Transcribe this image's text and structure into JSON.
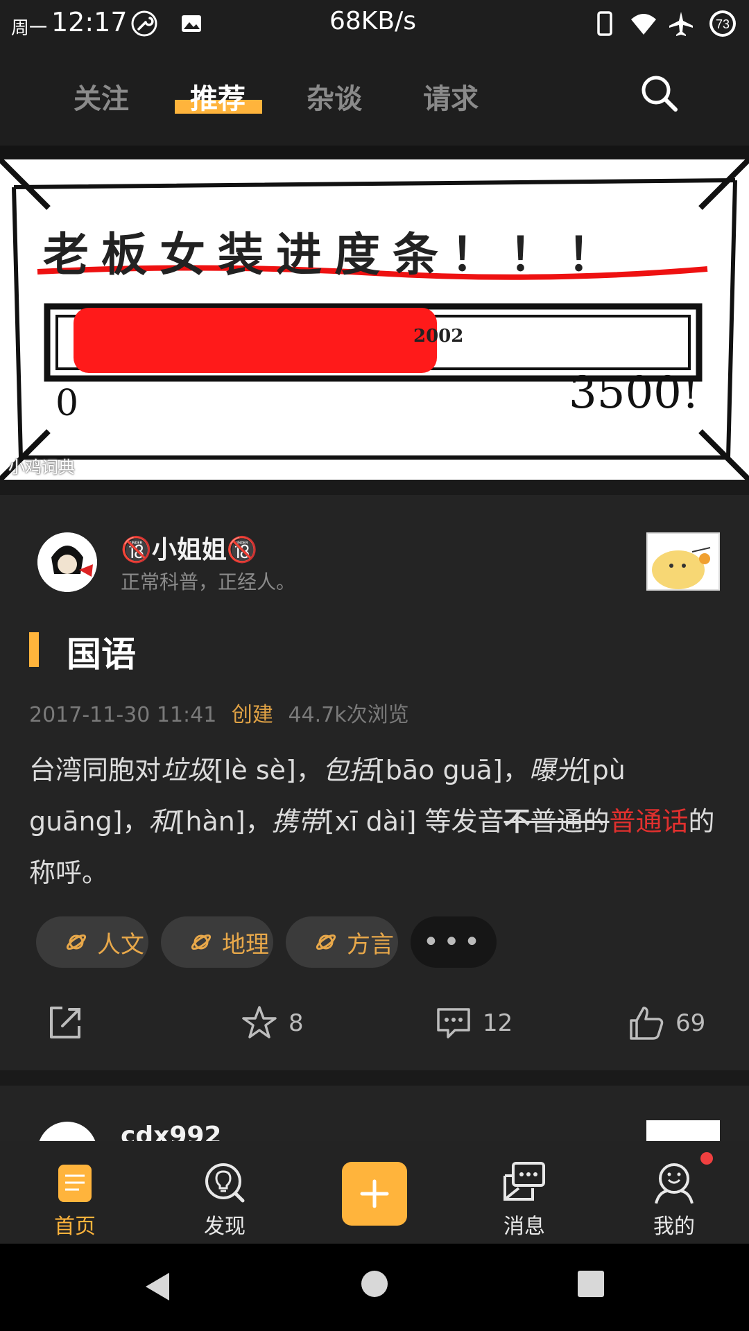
{
  "status_bar": {
    "weekday": "周一",
    "time": "12:17",
    "net_speed": "68KB/s",
    "battery": "73",
    "icons": [
      "wrench-icon",
      "image-icon",
      "phone-icon",
      "wifi-icon",
      "airplane-icon",
      "battery-icon"
    ]
  },
  "top_tabs": {
    "items": [
      "关注",
      "推荐",
      "杂谈",
      "请求"
    ],
    "active": "推荐",
    "accent": "#ffb43c"
  },
  "banner": {
    "title": "老板女装进度条！！！",
    "year_mark": "2002",
    "min": "0",
    "max": "3500!",
    "watermark": "小鸡词典",
    "progress": 0.57
  },
  "post": {
    "username": "🔞小姐姐🔞",
    "bio": "正常科普，正经人。",
    "title": "国语",
    "date": "2017-11-30 11:41",
    "created_label": "创建",
    "views": "44.7k次浏览",
    "body": {
      "p1": "台湾同胞对",
      "w1": "垃圾",
      "r1": "[lè sè]，",
      "w2": "包括",
      "r2": "[bāo guā]，",
      "w3": "曝光",
      "r3": "[pù guāng]，",
      "w4": "和",
      "r4": "[hàn]，",
      "w5": "携带",
      "r5": "[xī dài] 等发音",
      "strike_bold": "不",
      "strike_rest": "普通的",
      "red": "普通话",
      "tail": "的称呼。"
    },
    "tags": [
      "人文",
      "地理",
      "方言"
    ],
    "more_tags": "•••",
    "stats": {
      "favorites": "8",
      "comments": "12",
      "likes": "69"
    }
  },
  "next_post": {
    "username": "cdx992"
  },
  "bottom_nav": {
    "items": [
      {
        "label": "首页",
        "icon": "home-doc-icon",
        "active": true
      },
      {
        "label": "发现",
        "icon": "discover-bulb-icon",
        "active": false
      },
      {
        "label": "消息",
        "icon": "message-icon",
        "active": false
      },
      {
        "label": "我的",
        "icon": "profile-icon",
        "active": false
      }
    ],
    "badge_color": "#f04040"
  }
}
